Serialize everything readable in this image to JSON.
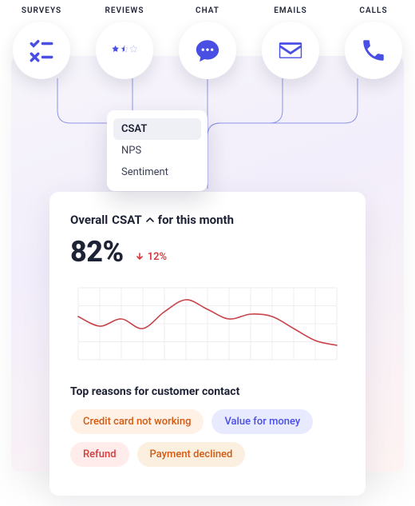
{
  "channels": [
    {
      "id": "surveys",
      "label": "SURVEYS"
    },
    {
      "id": "reviews",
      "label": "REVIEWS"
    },
    {
      "id": "chat",
      "label": "CHAT"
    },
    {
      "id": "emails",
      "label": "EMAILS"
    },
    {
      "id": "calls",
      "label": "CALLS"
    }
  ],
  "dropdown": {
    "items": [
      {
        "label": "CSAT",
        "selected": true
      },
      {
        "label": "NPS",
        "selected": false
      },
      {
        "label": "Sentiment",
        "selected": false
      }
    ]
  },
  "card": {
    "title_pre": "Overall",
    "title_metric": "CSAT",
    "title_post": "for this month",
    "metric_value": "82%",
    "delta_value": "12%",
    "delta_direction": "down",
    "section_title": "Top reasons for customer contact",
    "chips": [
      {
        "label": "Credit card not working",
        "tone": "orange"
      },
      {
        "label": "Value for money",
        "tone": "blue"
      },
      {
        "label": "Refund",
        "tone": "red"
      },
      {
        "label": "Payment declined",
        "tone": "amber"
      }
    ]
  },
  "colors": {
    "accent": "#4a4fe3",
    "line": "#c8434a",
    "grid": "#edeef3"
  },
  "chart_data": {
    "type": "line",
    "title": "Overall CSAT for this month",
    "xlabel": "",
    "ylabel": "",
    "ylim": [
      60,
      90
    ],
    "x": [
      0,
      1,
      2,
      3,
      4,
      5,
      6,
      7,
      8,
      9,
      10,
      11,
      12
    ],
    "values": [
      78,
      74,
      77,
      73,
      80,
      85,
      81,
      77,
      79,
      78,
      73,
      68,
      66
    ]
  }
}
